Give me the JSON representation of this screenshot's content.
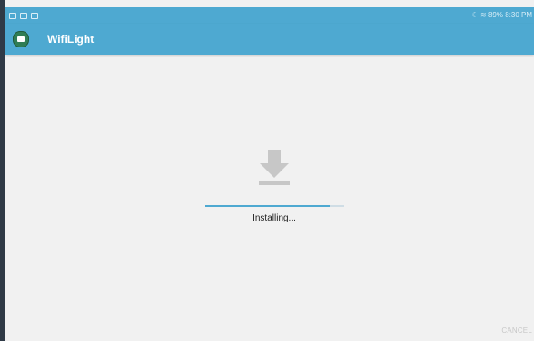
{
  "status_bar": {
    "right_text": "89% 8:30 PM"
  },
  "app_bar": {
    "title": "WifiLight"
  },
  "install": {
    "status_text": "Installing...",
    "progress_fraction": 0.9,
    "icon": "download-icon"
  },
  "actions": {
    "cancel_label": "CANCEL"
  },
  "colors": {
    "accent": "#4ea9d1",
    "background": "#f1f1f1",
    "icon_gray": "#c7c7c7"
  }
}
